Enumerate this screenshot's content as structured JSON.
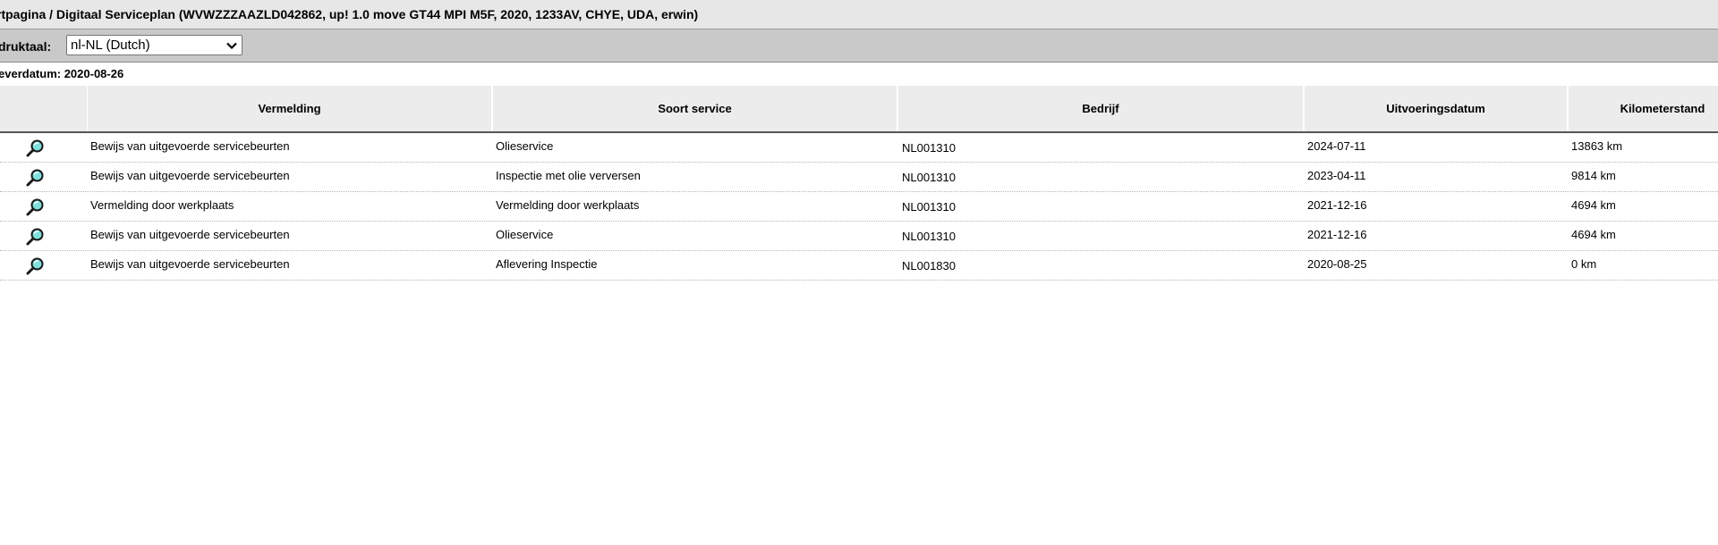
{
  "breadcrumb": {
    "text": "rtpagina / Digitaal Serviceplan (WVWZZZAAZLD042862, up! 1.0 move GT44 MPI M5F, 2020, 1233AV, CHYE, UDA, erwin)"
  },
  "language": {
    "label": "druktaal:",
    "selected": "nl-NL (Dutch)"
  },
  "delivery": {
    "text": "everdatum: 2020-08-26"
  },
  "table": {
    "headers": {
      "icon": "",
      "vermelding": "Vermelding",
      "soort": "Soort service",
      "bedrijf": "Bedrijf",
      "datum": "Uitvoeringsdatum",
      "km": "Kilometerstand"
    },
    "rows": [
      {
        "vermelding": "Bewijs van uitgevoerde servicebeurten",
        "soort": "Olieservice",
        "bedrijf": "NL001310",
        "datum": "2024-07-11",
        "km": "13863 km"
      },
      {
        "vermelding": "Bewijs van uitgevoerde servicebeurten",
        "soort": "Inspectie met olie verversen",
        "bedrijf": "NL001310",
        "datum": "2023-04-11",
        "km": "9814 km"
      },
      {
        "vermelding": "Vermelding door werkplaats",
        "soort": "Vermelding door werkplaats",
        "bedrijf": "NL001310",
        "datum": "2021-12-16",
        "km": "4694 km"
      },
      {
        "vermelding": "Bewijs van uitgevoerde servicebeurten",
        "soort": "Olieservice",
        "bedrijf": "NL001310",
        "datum": "2021-12-16",
        "km": "4694 km"
      },
      {
        "vermelding": "Bewijs van uitgevoerde servicebeurten",
        "soort": "Aflevering Inspectie",
        "bedrijf": "NL001830",
        "datum": "2020-08-25",
        "km": "0 km"
      }
    ]
  },
  "icons": {
    "detail": "magnifier-icon",
    "select_arrow": "chevron-down-icon"
  },
  "colors": {
    "breadcrumb_bg": "#e7e7e7",
    "language_bar_bg": "#c9c9c9",
    "header_bg": "#ececec",
    "magnifier_lens": "#7fe0dc"
  }
}
